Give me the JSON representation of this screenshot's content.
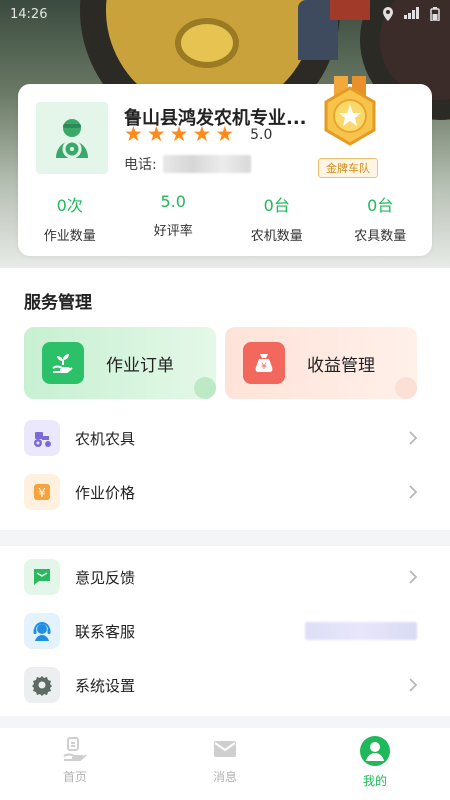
{
  "status_bar": {
    "time": "14:26"
  },
  "profile": {
    "name": "鲁山县鸿发农机专业...",
    "rating": "5.0",
    "phone_label": "电话:",
    "badge_label": "金牌车队",
    "stats": [
      {
        "value": "0次",
        "label": "作业数量"
      },
      {
        "value": "5.0",
        "label": "好评率"
      },
      {
        "value": "0台",
        "label": "农机数量"
      },
      {
        "value": "0台",
        "label": "农具数量"
      }
    ]
  },
  "service": {
    "title": "服务管理",
    "tiles": [
      {
        "label": "作业订单",
        "icon": "seedling-hand-icon"
      },
      {
        "label": "收益管理",
        "icon": "money-bag-icon"
      }
    ],
    "items": [
      {
        "label": "农机农具",
        "icon": "tractor-icon"
      },
      {
        "label": "作业价格",
        "icon": "yuan-price-icon"
      }
    ]
  },
  "support": {
    "items": [
      {
        "label": "意见反馈",
        "icon": "feedback-icon"
      },
      {
        "label": "联系客服",
        "icon": "customer-service-icon"
      },
      {
        "label": "系统设置",
        "icon": "settings-gear-icon"
      }
    ]
  },
  "tabbar": {
    "tabs": [
      {
        "label": "首页",
        "icon": "home-icon",
        "active": false
      },
      {
        "label": "消息",
        "icon": "mail-icon",
        "active": false
      },
      {
        "label": "我的",
        "icon": "user-icon",
        "active": true
      }
    ]
  },
  "colors": {
    "accent": "#1fb85a",
    "star": "#ff8a1c",
    "badge": "#d08a16"
  }
}
